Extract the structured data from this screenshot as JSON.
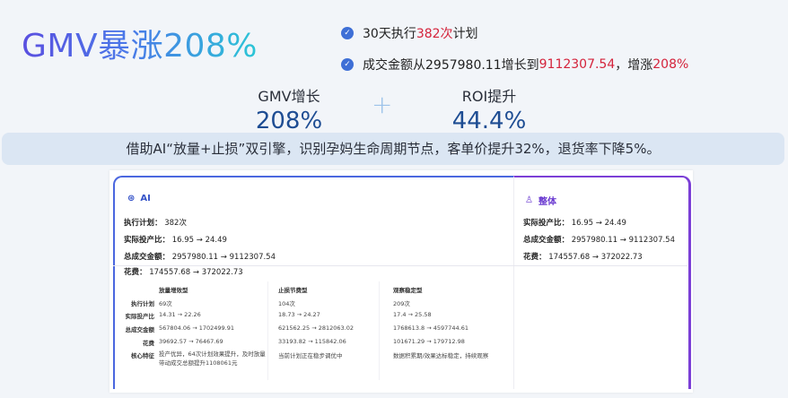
{
  "headline": "GMV暴涨208%",
  "bullets": [
    {
      "pre": "30天执行",
      "hl": "382次",
      "post": "计划"
    },
    {
      "pre": "成交金额从2957980.11增长到",
      "hl": "9112307.54",
      "mid": "，增涨",
      "hl2": "208%"
    }
  ],
  "metrics": [
    {
      "label": "GMV增长",
      "value": "208%"
    },
    {
      "label": "ROI提升",
      "value": "44.4%"
    }
  ],
  "plus": "+",
  "banner": "借助AI“放量+止损”双引擎，识别孕妈生命周期节点，客单价提升32%，退货率下降5%。",
  "ai_panel": {
    "title": "AI",
    "stats": [
      {
        "label": "执行计划：",
        "value": "382次"
      },
      {
        "label": "实际投产比：",
        "value": "16.95 → 24.49"
      },
      {
        "label": "总成交金额：",
        "value": "2957980.11 → 9112307.54"
      },
      {
        "label": "花费：",
        "value": "174557.68 → 372022.73"
      }
    ],
    "table": {
      "columns": [
        "放量增效型",
        "止损节费型",
        "观察稳定型"
      ],
      "rows": [
        {
          "label": "执行计划",
          "cells": [
            "69次",
            "104次",
            "209次"
          ]
        },
        {
          "label": "实际投产比",
          "cells": [
            "14.31 → 22.26",
            "18.73 → 24.27",
            "17.4 → 25.58"
          ]
        },
        {
          "label": "总成交金额",
          "cells": [
            "567804.06 → 1702499.91",
            "621562.25 → 2812063.02",
            "1768613.8 → 4597744.61"
          ]
        },
        {
          "label": "花费",
          "cells": [
            "39692.57 → 76467.69",
            "33193.82 → 115842.06",
            "101671.29 → 179712.98"
          ]
        },
        {
          "label": "核心特征",
          "cells": [
            "投产优异，64次计划效果提升，及时放量带动成交总额提升1108061元",
            "当前计划正在稳步调优中",
            "数据积累期/效果达标稳定，持续观察"
          ]
        }
      ]
    }
  },
  "overall_panel": {
    "title": "整体",
    "stats": [
      {
        "label": "实际投产比：",
        "value": "16.95 → 24.49"
      },
      {
        "label": "总成交金额：",
        "value": "2957980.11 → 9112307.54"
      },
      {
        "label": "花费：",
        "value": "174557.68 → 372022.73"
      }
    ]
  },
  "icons": {
    "check": "check-circle-icon",
    "ai": "ai-bot-icon",
    "overall": "user-icon"
  },
  "colors": {
    "accent_blue": "#3e6fd6",
    "highlight_red": "#d4233b",
    "ai_border": "#4b67df",
    "overall_border": "#7b3fd6",
    "metric_value": "#1e4d93"
  }
}
